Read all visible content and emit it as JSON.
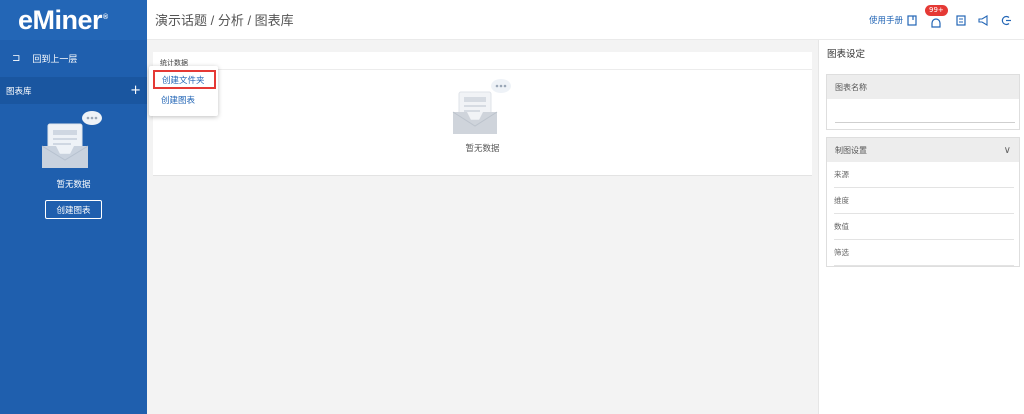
{
  "sidebar": {
    "logo": "eMiner",
    "logo_mark": "®",
    "back_label": "回到上一层",
    "library_label": "图表库",
    "add_label": "+",
    "empty_text": "暂无数据",
    "create_button": "创建图表"
  },
  "header": {
    "breadcrumb": "演示话题 / 分析 / 图表库",
    "manual_label": "使用手册",
    "badge": "99+",
    "icons": [
      "book-icon",
      "bell-icon",
      "list-icon",
      "announce-icon",
      "logout-icon"
    ]
  },
  "main": {
    "panel_title": "统计数据",
    "empty_text": "暂无数据"
  },
  "popup": {
    "items": [
      "创建文件夹",
      "创建图表"
    ]
  },
  "right_panel": {
    "title": "图表设定",
    "name_section": "图表名称",
    "config_section": "制图设置",
    "fields": [
      "来源",
      "维度",
      "数值",
      "筛选"
    ]
  },
  "colors": {
    "sidebar": "#1f5fae",
    "accent": "#2366b6",
    "badge": "#e53935",
    "highlight_border": "#e53935"
  }
}
